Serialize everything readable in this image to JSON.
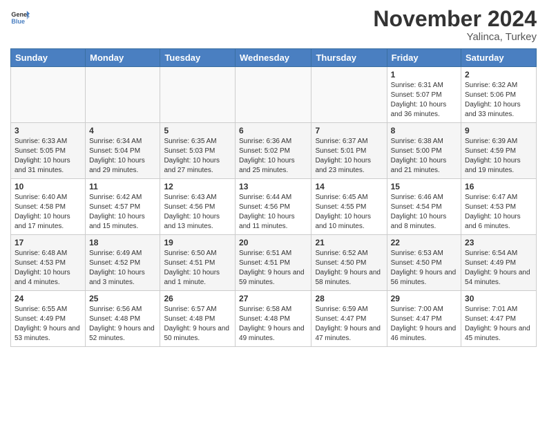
{
  "logo": {
    "line1": "General",
    "line2": "Blue"
  },
  "title": "November 2024",
  "subtitle": "Yalinca, Turkey",
  "days_header": [
    "Sunday",
    "Monday",
    "Tuesday",
    "Wednesday",
    "Thursday",
    "Friday",
    "Saturday"
  ],
  "weeks": [
    [
      {
        "num": "",
        "info": ""
      },
      {
        "num": "",
        "info": ""
      },
      {
        "num": "",
        "info": ""
      },
      {
        "num": "",
        "info": ""
      },
      {
        "num": "",
        "info": ""
      },
      {
        "num": "1",
        "info": "Sunrise: 6:31 AM\nSunset: 5:07 PM\nDaylight: 10 hours and 36 minutes."
      },
      {
        "num": "2",
        "info": "Sunrise: 6:32 AM\nSunset: 5:06 PM\nDaylight: 10 hours and 33 minutes."
      }
    ],
    [
      {
        "num": "3",
        "info": "Sunrise: 6:33 AM\nSunset: 5:05 PM\nDaylight: 10 hours and 31 minutes."
      },
      {
        "num": "4",
        "info": "Sunrise: 6:34 AM\nSunset: 5:04 PM\nDaylight: 10 hours and 29 minutes."
      },
      {
        "num": "5",
        "info": "Sunrise: 6:35 AM\nSunset: 5:03 PM\nDaylight: 10 hours and 27 minutes."
      },
      {
        "num": "6",
        "info": "Sunrise: 6:36 AM\nSunset: 5:02 PM\nDaylight: 10 hours and 25 minutes."
      },
      {
        "num": "7",
        "info": "Sunrise: 6:37 AM\nSunset: 5:01 PM\nDaylight: 10 hours and 23 minutes."
      },
      {
        "num": "8",
        "info": "Sunrise: 6:38 AM\nSunset: 5:00 PM\nDaylight: 10 hours and 21 minutes."
      },
      {
        "num": "9",
        "info": "Sunrise: 6:39 AM\nSunset: 4:59 PM\nDaylight: 10 hours and 19 minutes."
      }
    ],
    [
      {
        "num": "10",
        "info": "Sunrise: 6:40 AM\nSunset: 4:58 PM\nDaylight: 10 hours and 17 minutes."
      },
      {
        "num": "11",
        "info": "Sunrise: 6:42 AM\nSunset: 4:57 PM\nDaylight: 10 hours and 15 minutes."
      },
      {
        "num": "12",
        "info": "Sunrise: 6:43 AM\nSunset: 4:56 PM\nDaylight: 10 hours and 13 minutes."
      },
      {
        "num": "13",
        "info": "Sunrise: 6:44 AM\nSunset: 4:56 PM\nDaylight: 10 hours and 11 minutes."
      },
      {
        "num": "14",
        "info": "Sunrise: 6:45 AM\nSunset: 4:55 PM\nDaylight: 10 hours and 10 minutes."
      },
      {
        "num": "15",
        "info": "Sunrise: 6:46 AM\nSunset: 4:54 PM\nDaylight: 10 hours and 8 minutes."
      },
      {
        "num": "16",
        "info": "Sunrise: 6:47 AM\nSunset: 4:53 PM\nDaylight: 10 hours and 6 minutes."
      }
    ],
    [
      {
        "num": "17",
        "info": "Sunrise: 6:48 AM\nSunset: 4:53 PM\nDaylight: 10 hours and 4 minutes."
      },
      {
        "num": "18",
        "info": "Sunrise: 6:49 AM\nSunset: 4:52 PM\nDaylight: 10 hours and 3 minutes."
      },
      {
        "num": "19",
        "info": "Sunrise: 6:50 AM\nSunset: 4:51 PM\nDaylight: 10 hours and 1 minute."
      },
      {
        "num": "20",
        "info": "Sunrise: 6:51 AM\nSunset: 4:51 PM\nDaylight: 9 hours and 59 minutes."
      },
      {
        "num": "21",
        "info": "Sunrise: 6:52 AM\nSunset: 4:50 PM\nDaylight: 9 hours and 58 minutes."
      },
      {
        "num": "22",
        "info": "Sunrise: 6:53 AM\nSunset: 4:50 PM\nDaylight: 9 hours and 56 minutes."
      },
      {
        "num": "23",
        "info": "Sunrise: 6:54 AM\nSunset: 4:49 PM\nDaylight: 9 hours and 54 minutes."
      }
    ],
    [
      {
        "num": "24",
        "info": "Sunrise: 6:55 AM\nSunset: 4:49 PM\nDaylight: 9 hours and 53 minutes."
      },
      {
        "num": "25",
        "info": "Sunrise: 6:56 AM\nSunset: 4:48 PM\nDaylight: 9 hours and 52 minutes."
      },
      {
        "num": "26",
        "info": "Sunrise: 6:57 AM\nSunset: 4:48 PM\nDaylight: 9 hours and 50 minutes."
      },
      {
        "num": "27",
        "info": "Sunrise: 6:58 AM\nSunset: 4:48 PM\nDaylight: 9 hours and 49 minutes."
      },
      {
        "num": "28",
        "info": "Sunrise: 6:59 AM\nSunset: 4:47 PM\nDaylight: 9 hours and 47 minutes."
      },
      {
        "num": "29",
        "info": "Sunrise: 7:00 AM\nSunset: 4:47 PM\nDaylight: 9 hours and 46 minutes."
      },
      {
        "num": "30",
        "info": "Sunrise: 7:01 AM\nSunset: 4:47 PM\nDaylight: 9 hours and 45 minutes."
      }
    ]
  ]
}
